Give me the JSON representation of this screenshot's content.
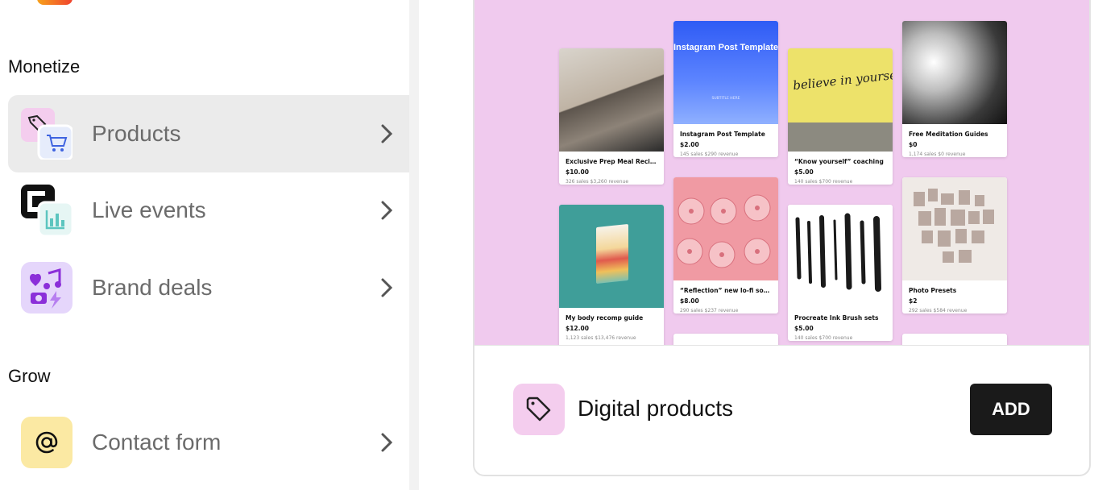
{
  "sidebar": {
    "sections": [
      {
        "title": "Monetize"
      },
      {
        "title": "Grow"
      }
    ],
    "items": [
      {
        "label": "Products",
        "icon": "tag-cart-icon"
      },
      {
        "label": "Live events",
        "icon": "calendar-icon"
      },
      {
        "label": "Brand deals",
        "icon": "heart-music-camera-icon"
      },
      {
        "label": "Contact form",
        "icon": "at-sign-icon"
      }
    ]
  },
  "card": {
    "title": "Digital products",
    "add_label": "ADD",
    "icon": "tag-icon",
    "tiles": [
      {
        "name": "Exclusive Prep Meal Recipe",
        "price": "$10.00",
        "stats": "326 sales   $3,260 revenue"
      },
      {
        "name": "My body recomp guide",
        "price": "$12.00",
        "stats": "1,123 sales   $13,476 revenue"
      },
      {
        "name": "Instagram Post Template",
        "price": "$2.00",
        "stats": "145 sales   $290 revenue",
        "image_text": "Instagram Post Template",
        "image_subtext": "SUBTITLE HERE"
      },
      {
        "name": "“Reflection” new lo-fi song ...",
        "price": "$8.00",
        "stats": "290 sales   $237 revenue"
      },
      {
        "name": "“Know yourself” coaching",
        "price": "$5.00",
        "stats": "140 sales   $700 revenue",
        "image_text": "believe in yourself"
      },
      {
        "name": "Procreate Ink Brush sets",
        "price": "$5.00",
        "stats": "140 sales   $700 revenue"
      },
      {
        "name": "Free Meditation Guides",
        "price": "$0",
        "stats": "1,174 sales   $0 revenue"
      },
      {
        "name": "Photo Presets",
        "price": "$2",
        "stats": "292 sales   $584 revenue"
      }
    ]
  },
  "colors": {
    "preview_bg": "#f0caee",
    "add_button": "#1a1a1a",
    "active_item": "#ebebeb"
  }
}
